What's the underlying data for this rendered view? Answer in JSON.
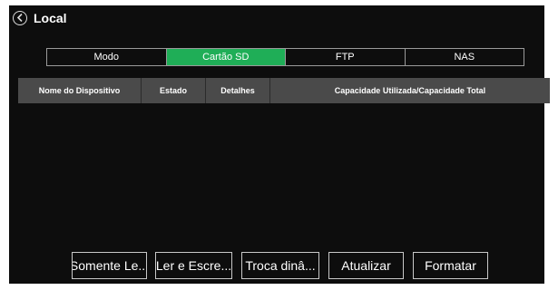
{
  "window": {
    "title": "Local",
    "close_label": "×",
    "back_icon": "chevron-left-circle-icon"
  },
  "tabs": [
    {
      "label": "Modo",
      "active": false
    },
    {
      "label": "Cartão SD",
      "active": true
    },
    {
      "label": "FTP",
      "active": false
    },
    {
      "label": "NAS",
      "active": false
    }
  ],
  "table": {
    "columns": [
      "Nome do Dispositivo",
      "Estado",
      "Detalhes",
      "Capacidade Utilizada/Capacidade Total"
    ],
    "rows": []
  },
  "actions": [
    "Somente Le...",
    "Ler e Escre...",
    "Troca dinâ...",
    "Atualizar",
    "Formatar"
  ],
  "colors": {
    "panel_bg": "#0d0d0d",
    "active_tab": "#1fae57",
    "header_bg": "#4a4a4a",
    "border": "#c8c8c8"
  }
}
